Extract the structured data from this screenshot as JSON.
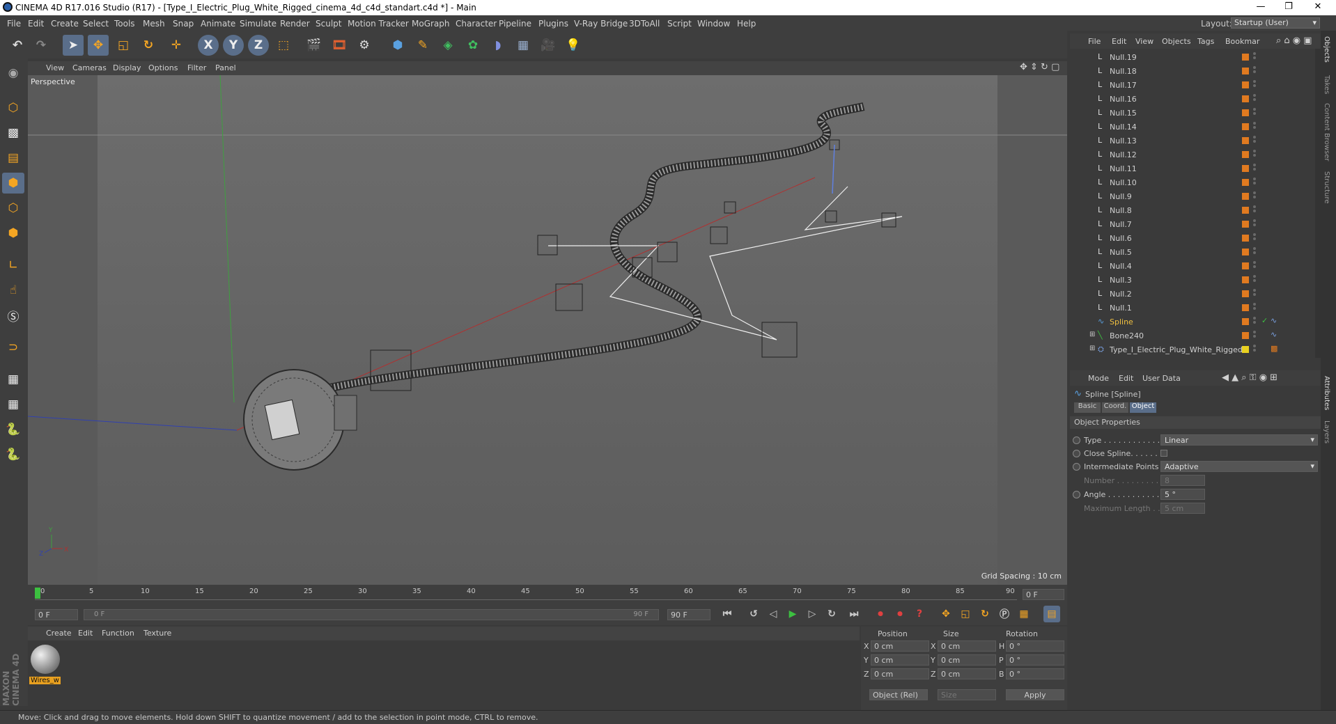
{
  "app": {
    "title": "CINEMA 4D R17.016 Studio (R17) - [Type_I_Electric_Plug_White_Rigged_cinema_4d_c4d_standart.c4d *] - Main",
    "window_controls": [
      "—",
      "❐",
      "✕"
    ]
  },
  "menubar": {
    "items": [
      "File",
      "Edit",
      "Create",
      "Select",
      "Tools",
      "Mesh",
      "Snap",
      "Animate",
      "Simulate",
      "Render",
      "Sculpt",
      "Motion Tracker",
      "MoGraph",
      "Character",
      "Pipeline",
      "Plugins",
      "V-Ray Bridge",
      "3DToAll",
      "Script",
      "Window",
      "Help"
    ],
    "layout_label": "Layout:",
    "layout_value": "Startup (User)"
  },
  "toolbar": {
    "icons": [
      "undo-icon",
      "redo-icon",
      "select-arrow-icon",
      "move-icon",
      "scale-icon",
      "rotate-icon",
      "live-select-icon",
      "x-axis-icon",
      "y-axis-icon",
      "z-axis-icon",
      "coordinate-system-icon",
      "render-view-icon",
      "render-picture-viewer-icon",
      "edit-render-settings-icon",
      "cube-icon",
      "pen-icon",
      "subdivision-icon",
      "cloner-icon",
      "deformer-icon",
      "floor-icon",
      "camera-icon",
      "light-icon"
    ],
    "axis_labels": [
      "X",
      "Y",
      "Z"
    ]
  },
  "viewport": {
    "menu": [
      "View",
      "Cameras",
      "Display",
      "Options",
      "Filter",
      "Panel"
    ],
    "label": "Perspective",
    "grid_spacing": "Grid Spacing : 10 cm",
    "axis_labels": [
      "Y",
      "X",
      "Z"
    ]
  },
  "timeline": {
    "ticks": [
      "0",
      "5",
      "10",
      "15",
      "20",
      "25",
      "30",
      "35",
      "40",
      "45",
      "50",
      "55",
      "60",
      "65",
      "70",
      "75",
      "80",
      "85",
      "90"
    ],
    "current_frame": "0 F",
    "start_frame": "0 F",
    "range_start": "0 F",
    "range_end": "90 F",
    "end_frame": "90 F"
  },
  "material_manager": {
    "menu": [
      "Create",
      "Edit",
      "Function",
      "Texture"
    ],
    "material_name": "Wires_w"
  },
  "coordinates": {
    "headers": [
      "Position",
      "Size",
      "Rotation"
    ],
    "rows": [
      {
        "axis": "X",
        "pos": "0 cm",
        "size_axis": "X",
        "size": "0 cm",
        "rot_axis": "H",
        "rot": "0 °"
      },
      {
        "axis": "Y",
        "pos": "0 cm",
        "size_axis": "Y",
        "size": "0 cm",
        "rot_axis": "P",
        "rot": "0 °"
      },
      {
        "axis": "Z",
        "pos": "0 cm",
        "size_axis": "Z",
        "size": "0 cm",
        "rot_axis": "B",
        "rot": "0 °"
      }
    ],
    "mode": "Object (Rel)",
    "size_mode": "Size",
    "apply_label": "Apply"
  },
  "object_manager": {
    "menu": [
      "File",
      "Edit",
      "View",
      "Objects",
      "Tags",
      "Bookmar"
    ],
    "objects": [
      {
        "name": "Null.19",
        "type": "null"
      },
      {
        "name": "Null.18",
        "type": "null"
      },
      {
        "name": "Null.17",
        "type": "null"
      },
      {
        "name": "Null.16",
        "type": "null"
      },
      {
        "name": "Null.15",
        "type": "null"
      },
      {
        "name": "Null.14",
        "type": "null"
      },
      {
        "name": "Null.13",
        "type": "null"
      },
      {
        "name": "Null.12",
        "type": "null"
      },
      {
        "name": "Null.11",
        "type": "null"
      },
      {
        "name": "Null.10",
        "type": "null"
      },
      {
        "name": "Null.9",
        "type": "null"
      },
      {
        "name": "Null.8",
        "type": "null"
      },
      {
        "name": "Null.7",
        "type": "null"
      },
      {
        "name": "Null.6",
        "type": "null"
      },
      {
        "name": "Null.5",
        "type": "null"
      },
      {
        "name": "Null.4",
        "type": "null"
      },
      {
        "name": "Null.3",
        "type": "null"
      },
      {
        "name": "Null.2",
        "type": "null"
      },
      {
        "name": "Null.1",
        "type": "null"
      },
      {
        "name": "Spline",
        "type": "spline"
      },
      {
        "name": "Bone240",
        "type": "bone"
      },
      {
        "name": "Type_I_Electric_Plug_White_Rigged",
        "type": "group"
      }
    ],
    "colors": {
      "null_tag": "#e07a20",
      "selected_text": "#f0c040",
      "group_tag": "#e8d020"
    }
  },
  "attributes": {
    "menu": [
      "Mode",
      "Edit",
      "User Data"
    ],
    "object_title": "Spline [Spline]",
    "tabs": [
      "Basic",
      "Coord.",
      "Object"
    ],
    "active_tab": "Object",
    "section": "Object Properties",
    "fields": [
      {
        "label": "Type . . . . . . . . . . . .",
        "value": "Linear",
        "kind": "dropdown"
      },
      {
        "label": "Close Spline. . . . . . .",
        "value": "",
        "kind": "checkbox"
      },
      {
        "label": "Intermediate Points",
        "value": "Adaptive",
        "kind": "dropdown"
      },
      {
        "label": "Number . . . . . . . . . .",
        "value": "8",
        "kind": "disabled"
      },
      {
        "label": "Angle . . . . . . . . . . . .",
        "value": "5 °",
        "kind": "number"
      },
      {
        "label": "Maximum Length . .",
        "value": "5 cm",
        "kind": "disabled"
      }
    ]
  },
  "side_tabs": [
    "Objects",
    "Takes",
    "Content Browser",
    "Structure",
    "Attributes",
    "Layers"
  ],
  "status": {
    "text": "Move: Click and drag to move elements. Hold down SHIFT to quantize movement / add to the selection in point mode, CTRL to remove."
  },
  "brand": {
    "logo_text": "MAXON CINEMA 4D"
  }
}
